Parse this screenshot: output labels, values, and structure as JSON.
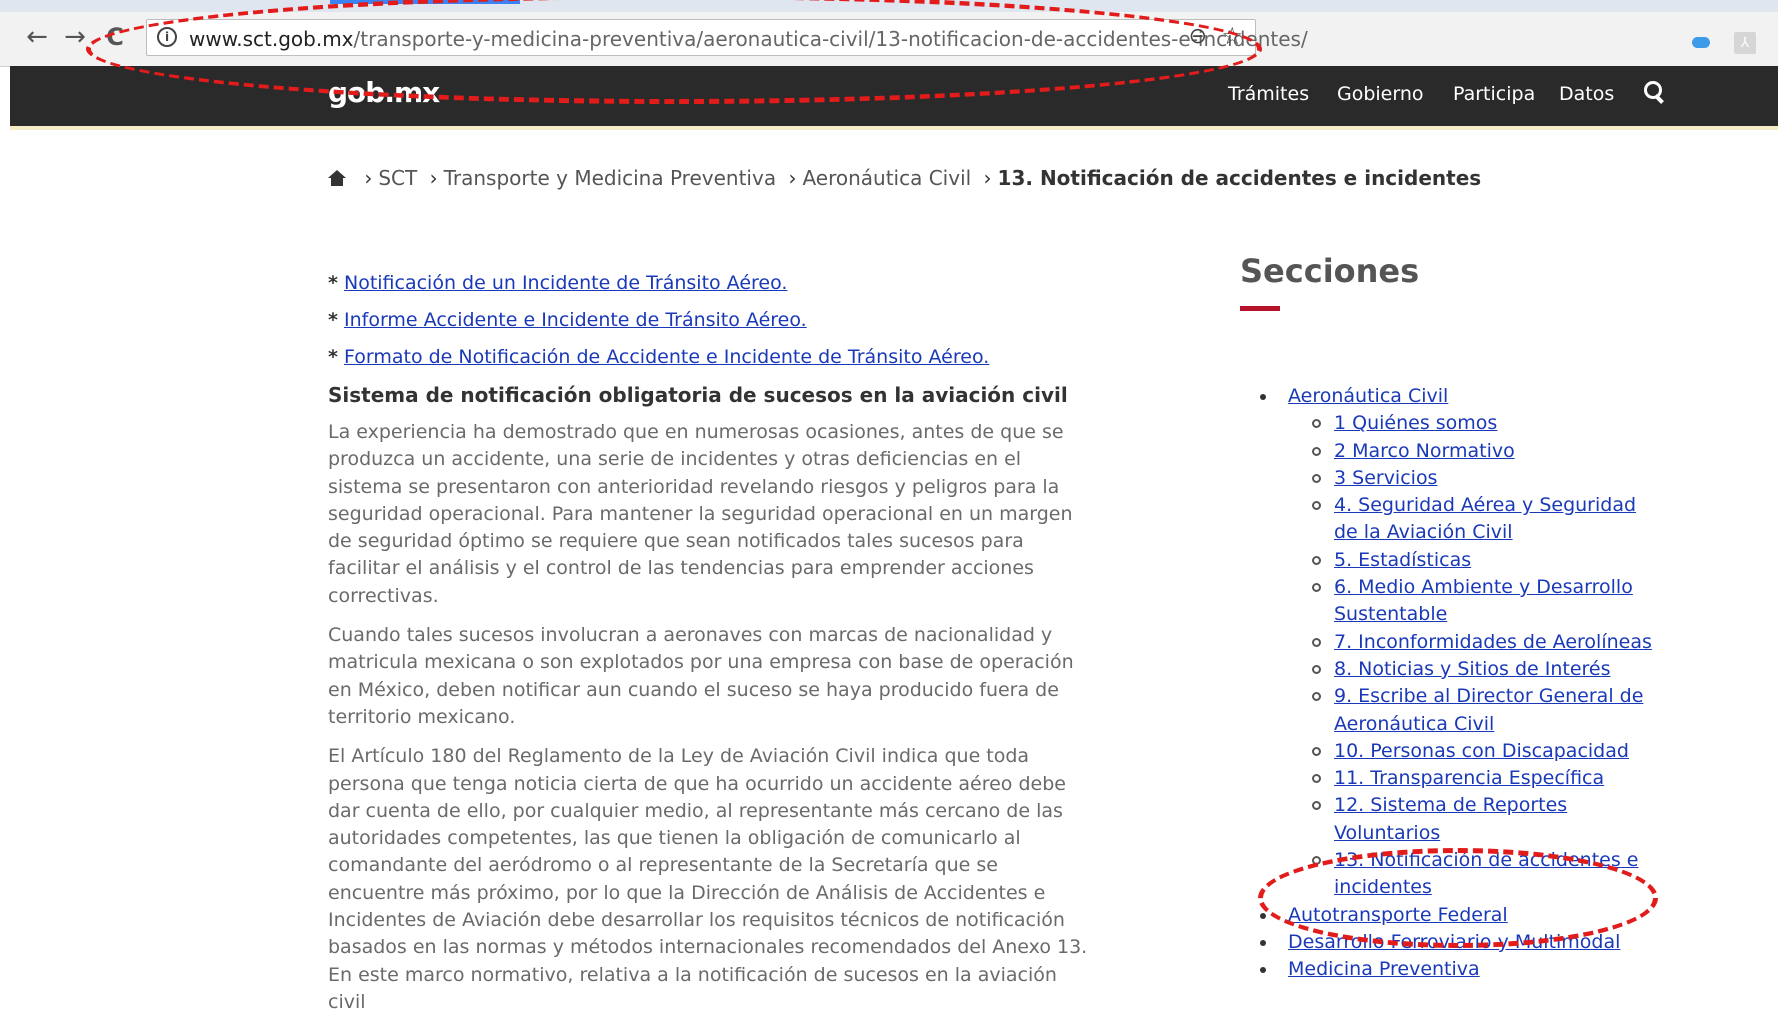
{
  "browser": {
    "url_host": "www.sct.gob.mx",
    "url_path": "/transporte-y-medicina-preventiva/aeronautica-civil/13-notificacion-de-accidentes-e-incidentes/",
    "back_icon": "←",
    "forward_icon": "→",
    "reload_icon": "C"
  },
  "header": {
    "logo": "gob.mx",
    "nav": [
      "Trámites",
      "Gobierno",
      "Participa",
      "Datos"
    ]
  },
  "breadcrumb": {
    "items": [
      "SCT",
      "Transporte y Medicina Preventiva",
      "Aeronáutica Civil"
    ],
    "current": "13. Notificación de accidentes e incidentes",
    "separator": "›"
  },
  "main": {
    "links": [
      "Notificación de un Incidente de Tránsito Aéreo.",
      "Informe Accidente e Incidente de Tránsito Aéreo.",
      "Formato de Notificación de Accidente e Incidente de Tránsito Aéreo."
    ],
    "link_bullet": "*",
    "heading": "Sistema de notificación obligatoria de sucesos en la aviación civil",
    "paragraphs": [
      "La experiencia ha demostrado que en numerosas ocasiones, antes de que se produzca un accidente, una serie de incidentes y otras deficiencias en el sistema se presentaron con anterioridad revelando riesgos y peligros para la seguridad operacional. Para mantener la seguridad operacional en un margen de seguridad óptimo se requiere que sean notificados tales sucesos  para facilitar el análisis y el control de las tendencias para emprender acciones correctivas.",
      "Cuando tales sucesos involucran a aeronaves con marcas de nacionalidad y matricula mexicana o son explotados por una empresa con base de operación en México, deben notificar aun cuando el suceso se haya producido fuera de territorio mexicano.",
      "El Artículo 180 del Reglamento de la Ley de Aviación Civil indica que toda persona que tenga noticia cierta de que ha ocurrido un accidente aéreo debe dar cuenta de ello, por cualquier medio, al representante más cercano de las autoridades competentes, las que tienen la obligación de comunicarlo al comandante del aeródromo o al representante de la Secretaría que se encuentre más próximo, por lo que la Dirección de Análisis de Accidentes e Incidentes de Aviación debe desarrollar los requisitos técnicos de notificación basados en las normas y métodos internacionales recomendados del Anexo 13. En este marco normativo, relativa a la notificación de sucesos en la aviación civil"
    ]
  },
  "sidebar": {
    "title": "Secciones",
    "sections": [
      {
        "label": "Aeronáutica Civil",
        "items": [
          "1 Quiénes somos",
          "2 Marco Normativo",
          "3 Servicios",
          "4. Seguridad Aérea y Seguridad de la Aviación Civil",
          "5. Estadísticas",
          "6. Medio Ambiente y Desarrollo Sustentable",
          "7. Inconformidades de Aerolíneas",
          "8. Noticias y Sitios de Interés",
          "9. Escribe al Director General de Aeronáutica Civil",
          "10. Personas con Discapacidad",
          "11. Transparencia Específica",
          "12. Sistema de Reportes Voluntarios",
          "13. Notificación de accidentes e incidentes"
        ]
      },
      {
        "label": "Autotransporte Federal",
        "items": []
      },
      {
        "label": "Desarrollo Ferroviario y Multimodal",
        "items": []
      },
      {
        "label": "Medicina Preventiva",
        "items": []
      }
    ]
  },
  "colors": {
    "annotation": "#e21b1b",
    "header_bg": "#2a2a2a",
    "accent": "#b5122c",
    "link": "#1a39b8"
  }
}
